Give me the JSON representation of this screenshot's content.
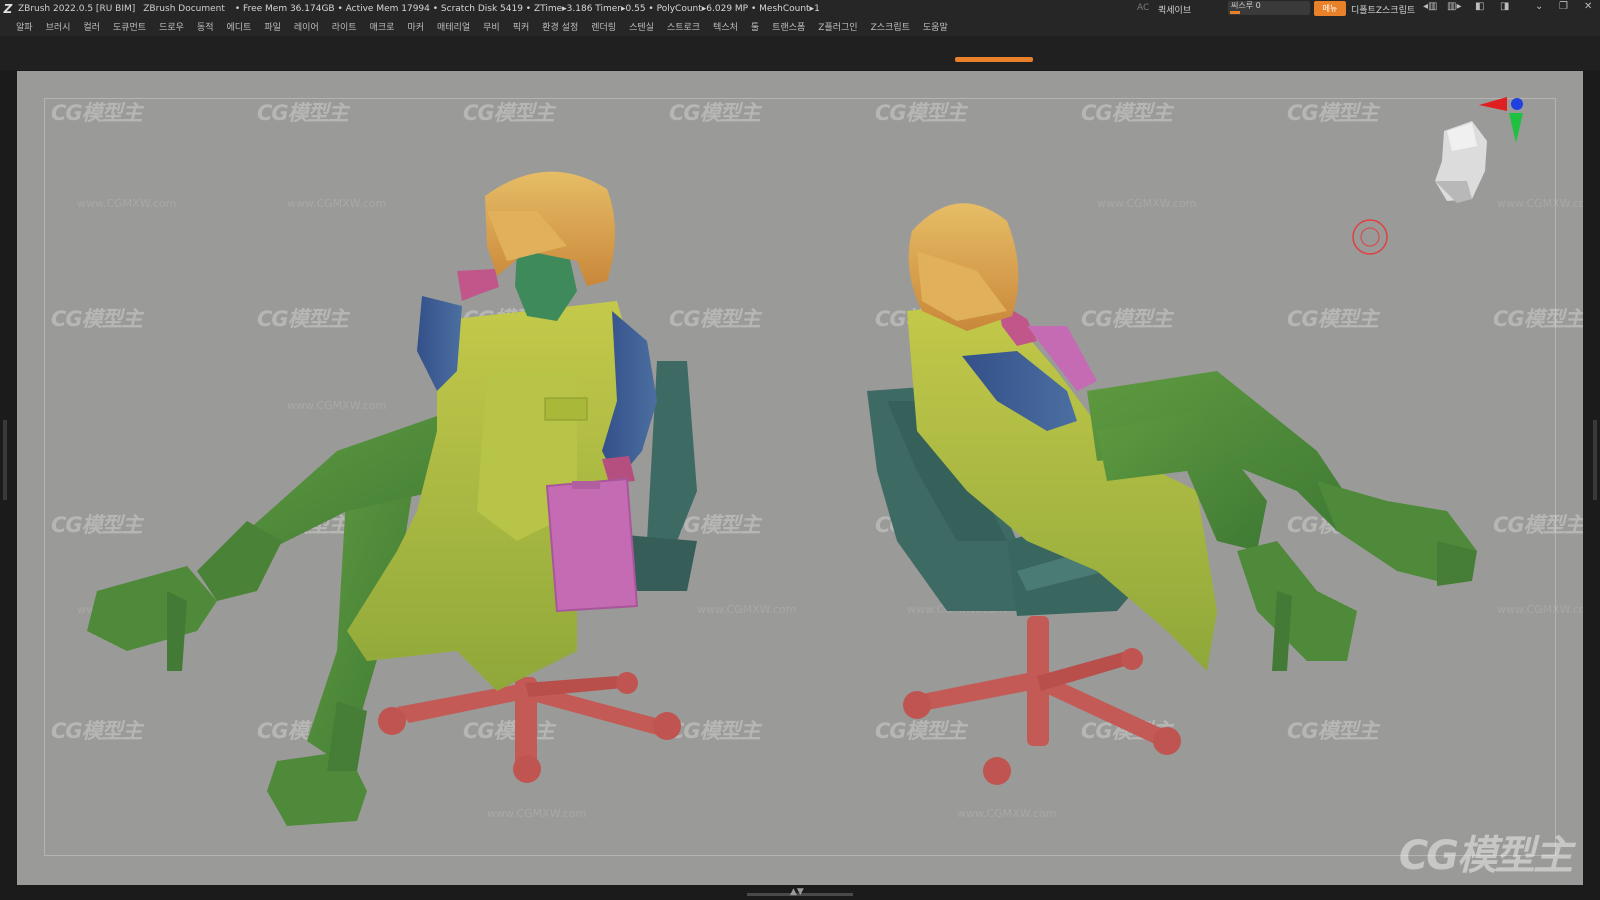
{
  "titlebar": {
    "app": "ZBrush 2022.0.5 [RU BIM]",
    "document": "ZBrush Document",
    "stats": "• Free Mem 36.174GB • Active Mem 17994 • Scratch Disk 5419 •  ZTime▸3.186 Timer▸0.55 • PolyCount▸6.029 MP  • MeshCount▸1",
    "ac": "AC",
    "quicksave": "퀵세이브",
    "see_through": "씨스루 0",
    "see_through_value": 0,
    "menu_button": "메뉴",
    "default_zscript": "디폴트Z스크립트"
  },
  "menu": [
    "알파",
    "브러시",
    "컬러",
    "도큐먼트",
    "드로우",
    "동적",
    "에디트",
    "파일",
    "레이어",
    "라이트",
    "매크로",
    "마커",
    "매테리얼",
    "무비",
    "픽커",
    "환경 설정",
    "렌더링",
    "스텐실",
    "스트로크",
    "텍스처",
    "툴",
    "트랜스폼",
    "Z플러그인",
    "Z스크립트",
    "도움말"
  ],
  "canvas": {
    "watermark": "CG模型主",
    "watermark_url": "www.CGMXW.com"
  },
  "colors": {
    "accent": "#e8812a",
    "canvas_bg": "#9a9a98",
    "skin_green": "#4f8a3a",
    "coat_yellow": "#a9b838",
    "sleeve_blue": "#3d5a8c",
    "hair_orange": "#d9a24a",
    "hand_pink": "#c0568a",
    "base_red": "#c45a55",
    "chair_teal": "#3e6a64",
    "clipboard_pink": "#c46bb3"
  },
  "icons": {
    "zbrush_logo": "Z",
    "navigator": "head-navigator-icon",
    "gizmo": "axis-gizmo-icon",
    "cursor": "brush-cursor-icon"
  }
}
